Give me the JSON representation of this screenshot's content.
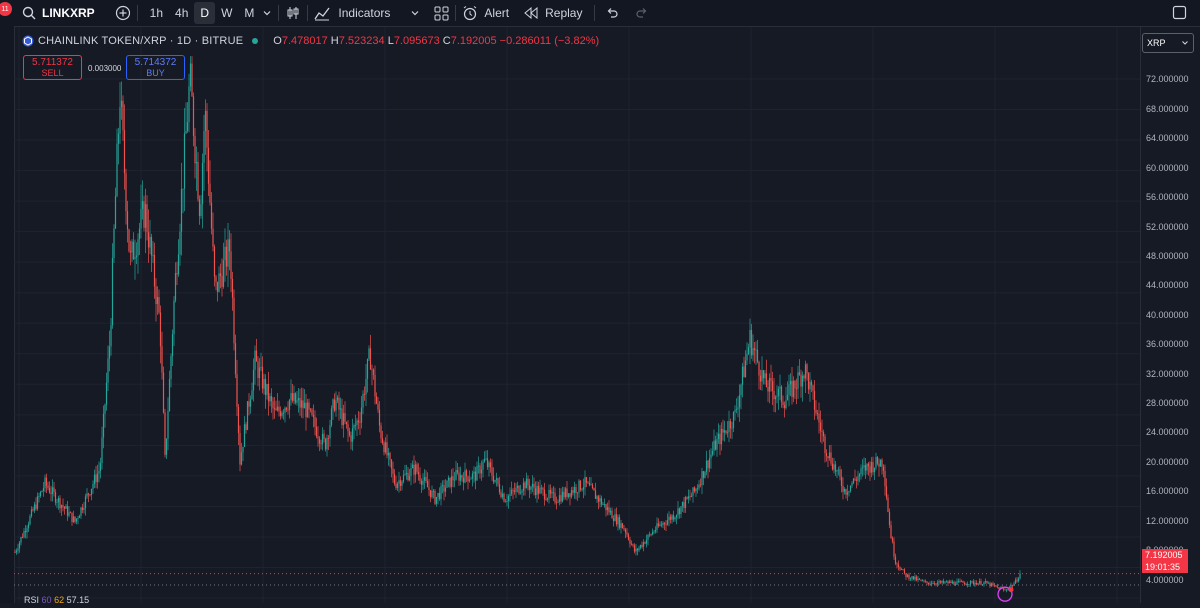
{
  "toolbar": {
    "badge": "11",
    "symbol": "LINKXRP",
    "intervals": [
      "1h",
      "4h",
      "D",
      "W",
      "M"
    ],
    "active_interval": "D",
    "indicators_label": "Indicators",
    "alert_label": "Alert",
    "replay_label": "Replay"
  },
  "legend": {
    "title": "CHAINLINK TOKEN/XRP · 1D · BITRUE",
    "open_key": "O",
    "open": "7.478017",
    "high_key": "H",
    "high": "7.523234",
    "low_key": "L",
    "low": "7.095673",
    "close_key": "C",
    "close": "7.192005",
    "change": "−0.286011 (−3.82%)"
  },
  "trade": {
    "sell_price": "5.711372",
    "sell_label": "SELL",
    "spread": "0.003000",
    "buy_price": "5.714372",
    "buy_label": "BUY"
  },
  "price_axis": {
    "ticks": [
      "72.000000",
      "68.000000",
      "64.000000",
      "60.000000",
      "56.000000",
      "52.000000",
      "48.000000",
      "44.000000",
      "40.000000",
      "36.000000",
      "32.000000",
      "28.000000",
      "24.000000",
      "20.000000",
      "16.000000",
      "12.000000",
      "8.000000",
      "4.000000"
    ],
    "current_price": "7.192005",
    "countdown": "19:01:35",
    "currency_select": "XRP"
  },
  "rsi": {
    "label": "RSI",
    "v1": "60",
    "v2": "62",
    "v3": "57.15"
  },
  "colors": {
    "up": "#26a69a",
    "down": "#ef5350",
    "background": "#161a25"
  },
  "chart_data": {
    "type": "candlestick",
    "ylim": [
      4,
      76
    ],
    "x": [
      0,
      30,
      60,
      85,
      95,
      100,
      105,
      115,
      130,
      145,
      150,
      160,
      175,
      185,
      190,
      200,
      215,
      225,
      240,
      260,
      275,
      290,
      310,
      320,
      335,
      345,
      355,
      365,
      380,
      400,
      420,
      440,
      460,
      470,
      490,
      510,
      540,
      570,
      590,
      610,
      620,
      640,
      660,
      680,
      700,
      720,
      735,
      750,
      770,
      790,
      810,
      830,
      850,
      868,
      875,
      880,
      890,
      910,
      940,
      970,
      990,
      1000,
      1005
    ],
    "y": [
      10,
      19,
      14,
      21,
      38,
      55,
      70,
      48,
      55,
      40,
      22,
      45,
      72,
      55,
      68,
      44,
      50,
      22,
      35,
      28,
      30,
      29,
      24,
      30,
      25,
      28,
      36,
      26,
      19,
      21,
      17,
      20,
      20,
      22,
      17,
      19,
      17,
      19,
      16,
      13,
      10,
      13,
      15,
      18,
      24,
      28,
      38,
      32,
      30,
      34,
      24,
      18,
      21,
      22,
      13,
      9,
      7,
      6,
      6,
      6,
      5,
      6,
      7.19
    ]
  }
}
